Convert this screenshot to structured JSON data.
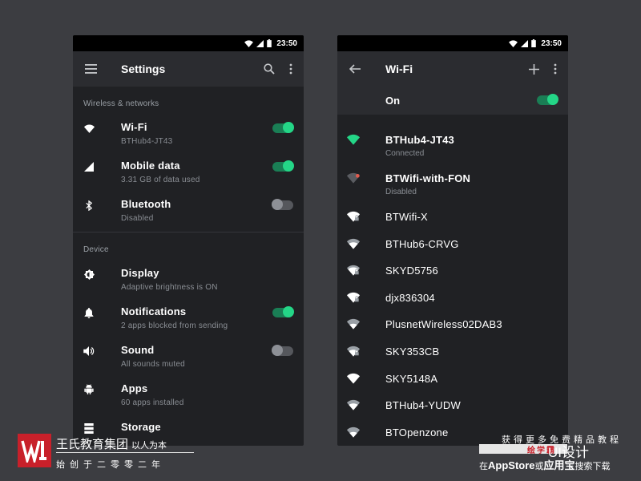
{
  "statusbar": {
    "time": "23:50"
  },
  "settings": {
    "title": "Settings",
    "sections": [
      {
        "header": "Wireless & networks",
        "items": [
          {
            "icon": "wifi-icon",
            "title": "Wi-Fi",
            "subtitle": "BTHub4-JT43",
            "toggle": true
          },
          {
            "icon": "mobile-signal-icon",
            "title": "Mobile data",
            "subtitle": "3.31 GB of data used",
            "toggle": true
          },
          {
            "icon": "bluetooth-icon",
            "title": "Bluetooth",
            "subtitle": "Disabled",
            "toggle": false
          }
        ]
      },
      {
        "header": "Device",
        "items": [
          {
            "icon": "brightness-icon",
            "title": "Display",
            "subtitle": "Adaptive brightness is ON"
          },
          {
            "icon": "bell-icon",
            "title": "Notifications",
            "subtitle": "2 apps blocked from sending",
            "toggle": true
          },
          {
            "icon": "speaker-icon",
            "title": "Sound",
            "subtitle": "All sounds muted",
            "toggle": false
          },
          {
            "icon": "android-icon",
            "title": "Apps",
            "subtitle": "60 apps installed"
          },
          {
            "icon": "storage-icon",
            "title": "Storage",
            "subtitle": ""
          }
        ]
      }
    ]
  },
  "wifi": {
    "title": "Wi-Fi",
    "switch_label": "On",
    "switch_on": true,
    "networks": [
      {
        "name": "BTHub4-JT43",
        "status": "Connected",
        "icon": "wifi-connected-icon"
      },
      {
        "name": "BTWifi-with-FON",
        "status": "Disabled",
        "icon": "wifi-disabled-icon"
      },
      {
        "name": "BTWifi-X",
        "status": "",
        "icon": "wifi-locked-icon"
      },
      {
        "name": "BTHub6-CRVG",
        "status": "",
        "icon": "wifi-icon"
      },
      {
        "name": "SKYD5756",
        "status": "",
        "icon": "wifi-locked-icon"
      },
      {
        "name": "djx836304",
        "status": "",
        "icon": "wifi-locked-icon"
      },
      {
        "name": "PlusnetWireless02DAB3",
        "status": "",
        "icon": "wifi-icon"
      },
      {
        "name": "SKY353CB",
        "status": "",
        "icon": "wifi-locked-icon"
      },
      {
        "name": "SKY5148A",
        "status": "",
        "icon": "wifi-icon"
      },
      {
        "name": "BTHub4-YUDW",
        "status": "",
        "icon": "wifi-icon"
      },
      {
        "name": "BTOpenzone",
        "status": "",
        "icon": "wifi-icon"
      }
    ]
  },
  "colors": {
    "accent": "#24d687",
    "toggle_track_on": "#1a7e55",
    "background": "#202124",
    "appbar": "#2b2c30"
  },
  "watermark_left": {
    "title": "王氏教育集团",
    "slogan": "以人为本",
    "subtitle": "始创于二零零二年"
  },
  "watermark_right": {
    "line1": "获得更多免费精品教程",
    "band_text": "绘学霸",
    "brand": "UI设计",
    "line3_prefix": "在",
    "line3_appstore": "AppStore",
    "line3_mid": "或",
    "line3_store2": "应用宝",
    "line3_suffix": "搜索下载"
  }
}
